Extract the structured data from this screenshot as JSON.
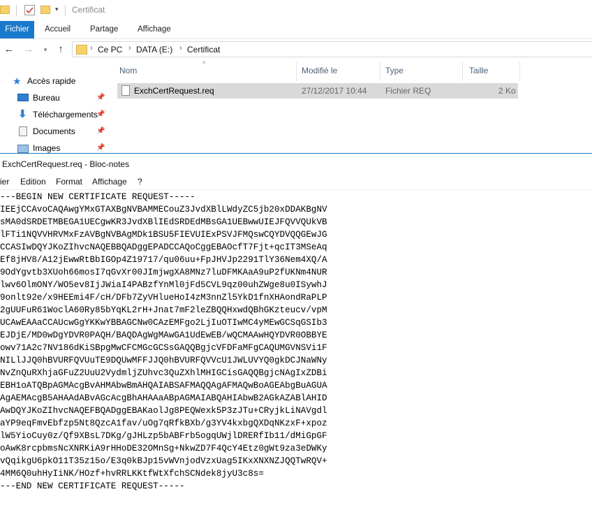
{
  "explorer": {
    "title": "Certificat",
    "ribbon_tabs": [
      "Fichier",
      "Accueil",
      "Partage",
      "Affichage"
    ],
    "breadcrumb": [
      "Ce PC",
      "DATA (E:)",
      "Certificat"
    ],
    "nav_items": [
      {
        "label": "Accès rapide",
        "icon": "star-icon"
      },
      {
        "label": "Bureau",
        "icon": "desktop-icon"
      },
      {
        "label": "Téléchargements",
        "icon": "download-icon"
      },
      {
        "label": "Documents",
        "icon": "documents-icon"
      },
      {
        "label": "Images",
        "icon": "images-icon"
      }
    ],
    "columns": [
      "Nom",
      "Modifié le",
      "Type",
      "Taille"
    ],
    "file": {
      "name": "ExchCertRequest.req",
      "modified": "27/12/2017 10:44",
      "type": "Fichier REQ",
      "size": "2 Ko"
    }
  },
  "notepad": {
    "title": "ExchCertRequest.req - Bloc-notes",
    "menu": [
      "ier",
      "Edition",
      "Format",
      "Affichage",
      "?"
    ],
    "lines": [
      "---BEGIN NEW CERTIFICATE REQUEST-----",
      "IEEjCCAvoCAQAwgYMxGTAXBgNVBAMMECouZ3JvdXBlLWdyZC5jb20xDDAKBgNV",
      "sMA0dSRDETMBEGA1UECgwKR3JvdXBlIEdSRDEdMBsGA1UEBwwUIEJFQVVQUkVB",
      "lFTi1NQVVHRVMxFzAVBgNVBAgMDk1BSU5FIEVUIExPSVJFMQswCQYDVQQGEwJG",
      "CCASIwDQYJKoZIhvcNAQEBBQADggEPADCCAQoCggEBAOcfT7Fjt+qcIT3MSeAq",
      "Ef8jHV8/A12jEwwRtBbIGOp4Z19717/qu06uu+FpJHVJp2291TlY36Nem4XQ/A",
      "9OdYgvtb3XUoh66mosI7qGvXr00JImjwgXA8MNz7luDFMKAaA9uP2fUKNm4NUR",
      "lwv6OlmONY/WO5ev8IjJWiaI4PABzfYnMl0jFd5CVL9qz00uhZWge8u0ISywhJ",
      "9onlt92e/x9HEEmi4F/cH/DFb7ZyVHlueHoI4zM3nnZl5YkD1fnXHAondRaPLP",
      "2gUUFuR61WoclA60Ry85bYqKL2rH+Jnat7mF2leZBQQHxwdQBhGKzteucv/vpM",
      "UCAwEAAaCCAUcwGgYKKwYBBAGCNw0CAzEMFgo2LjIuOTIwMC4yMEwGCSqGSIb3",
      "EJDjE/MD0wDgYDVR0PAQH/BAQDAgWgMAwGA1UdEwEB/wQCMAAwHQYDVR0OBBYE",
      "owv71A2c7NV186dKiSBpgMwCFCMGcGCSsGAQQBgjcVFDFaMFgCAQUMGVNSVi1F",
      "NILlJJQ0hBVURFQVUuTE9DQUwMFFJJQ0hBVURFQVVcU1JWLUVYQ0gkDCJNaWNy",
      "NvZnQuRXhjaGFuZ2UuU2VydmljZUhvc3QuZXhlMHIGCisGAQQBgjcNAgIxZDBi",
      "EBH1oATQBpAGMAcgBvAHMAbwBmAHQAIABSAFMAQQAgAFMAQwBoAGEAbgBuAGUA",
      "AgAEMAcgB5AHAAdABvAGcAcgBhAHAAaABpAGMAIABQAHIAbwB2AGkAZABlAHID",
      "AwDQYJKoZIhvcNAQEFBQADggEBAKaolJg8PEQWexk5P3zJTu+CRyjkLiNAVgdl",
      "aYP9eqFmvEbfzp5Nt8QzcA1fav/uOg7qRfkBXb/g3YV4kxbgQXDqNKzxF+xpoz",
      "lW5YioCuy0z/Qf9XBsL7DKg/gJHLzp5bABFrb5ogqUWjlDRERfIb11/dMiGpGF",
      "oAwK8rcpbmsNcXNRKiA9rHHoDE32OMnSg+NkwZD7F4QcY4Etz0gWt9za3eDWKy",
      "vQqikgU6pkO11T35z15o/E3q0kBJp15vWVnjodVzxUag5IKxXNXNZJQQTwRQV+",
      "4MM6Q0uhHyIiNK/HOzf+hvRRLKKtfWtXfchSCNdek8jyU3c8s=",
      "---END NEW CERTIFICATE REQUEST-----"
    ]
  }
}
